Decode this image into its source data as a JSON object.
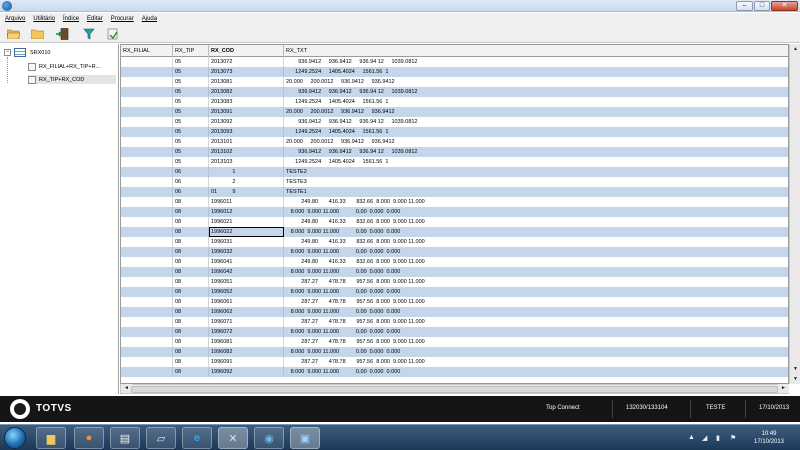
{
  "menu": [
    "Arquivo",
    "Utilitário",
    "Índice",
    "Editar",
    "Procurar",
    "Ajuda"
  ],
  "toolbar": {
    "icons": [
      "open-folder-icon",
      "folder-icon",
      "exit-door-icon",
      "filter-icon",
      "export-icon"
    ]
  },
  "tree": {
    "table_name": "SRX010",
    "indexes": [
      "RX_FILIAL+RX_TIP+R...",
      "RX_TIP+RX_COD"
    ],
    "expander": "−"
  },
  "grid": {
    "columns": [
      "RX_FILIAL",
      "RX_TIP",
      "RX_COD",
      "RX_TXT"
    ],
    "rows": [
      [
        "",
        "05",
        "2013072",
        "        936.9412     936.9412     936.94 12     1039.0812"
      ],
      [
        "",
        "05",
        "2013073",
        "      1249.2524     1405.4024     1561.56  1"
      ],
      [
        "",
        "05",
        "2013081",
        "20.000     200.0012     936.9412     936.9412"
      ],
      [
        "",
        "05",
        "2013082",
        "        936.9412     936.9412     936.94 12     1039.0812"
      ],
      [
        "",
        "05",
        "2013083",
        "      1249.2524     1405.4024     1561.56  1"
      ],
      [
        "",
        "05",
        "2013091",
        "20.000     200.0012     936.9412     936.9412"
      ],
      [
        "",
        "05",
        "2013092",
        "        936.9412     936.9412     936.94 12     1039.0812"
      ],
      [
        "",
        "05",
        "2013093",
        "      1249.2524     1405.4024     1561.56  1"
      ],
      [
        "",
        "05",
        "2013101",
        "20.000     200.0012     936.9412     936.9412"
      ],
      [
        "",
        "05",
        "2013102",
        "        936.9412     936.9412     936.94 12     1039.0812"
      ],
      [
        "",
        "05",
        "2013103",
        "      1249.2524     1405.4024     1561.56  1"
      ],
      [
        "",
        "06",
        "              1",
        "TESTE2"
      ],
      [
        "",
        "06",
        "              2",
        "TESTE3"
      ],
      [
        "",
        "06",
        "01          9",
        "TESTE1"
      ],
      [
        "",
        "08",
        "1996011",
        "          249.80       416.33       832.66  8.000  9.000 11.000"
      ],
      [
        "",
        "08",
        "1996012",
        "   8.000  9.000 11.000           0.00  0.000  0.000"
      ],
      [
        "",
        "08",
        "1996021",
        "          249.80       416.33       832.66  8.000  9.000 11.000"
      ],
      [
        "",
        "08",
        "1996022",
        "   8.000  9.000 11.000           0.00  0.000  0.000"
      ],
      [
        "",
        "08",
        "1996031",
        "          249.80       416.33       832.66  8.000  9.000 11.000"
      ],
      [
        "",
        "08",
        "1996032",
        "   8.000  9.000 11.000           0.00  0.000  0.000"
      ],
      [
        "",
        "08",
        "1996041",
        "          249.80       416.33       832.66  8.000  9.000 11.000"
      ],
      [
        "",
        "08",
        "1996042",
        "   8.000  9.000 11.000           0.00  0.000  0.000"
      ],
      [
        "",
        "08",
        "1996051",
        "          287.27       478.78       957.56  8.000  9.000 11.000"
      ],
      [
        "",
        "08",
        "1996052",
        "   8.000  9.000 11.000           0.00  0.000  0.000"
      ],
      [
        "",
        "08",
        "1996061",
        "          287.27       478.78       957.56  8.000  9.000 11.000"
      ],
      [
        "",
        "08",
        "1996062",
        "   8.000  9.000 11.000           0.00  0.000  0.000"
      ],
      [
        "",
        "08",
        "1996071",
        "          287.27       478.78       957.56  8.000  9.000 11.000"
      ],
      [
        "",
        "08",
        "1996072",
        "   8.000  9.000 11.000           0.00  0.000  0.000"
      ],
      [
        "",
        "08",
        "1996081",
        "          287.27       478.78       957.56  8.000  9.000 11.000"
      ],
      [
        "",
        "08",
        "1996082",
        "   8.000  9.000 11.000           0.00  0.000  0.000"
      ],
      [
        "",
        "08",
        "1996091",
        "          287.27       478.78       957.56  8.000  9.000 11.000"
      ],
      [
        "",
        "08",
        "1996092",
        "   8.000  9.000 11.000           0.00  0.000  0.000"
      ]
    ],
    "focused_row": 17,
    "focused_col": 2
  },
  "scroll": {
    "up": "▲",
    "down": "▼",
    "left": "◄",
    "right": "►"
  },
  "status": {
    "brand": "TOTVS",
    "connection": "Top Connect",
    "server": "132030/133104",
    "user": "TESTE",
    "date": "17/10/2013"
  },
  "window_buttons": {
    "minimize": "–",
    "maximize": "□",
    "close": "✕"
  },
  "taskbar": {
    "apps": [
      "folder-icon",
      "firefox-icon",
      "report-icon",
      "file-icon",
      "ie-icon",
      "tools-icon",
      "network-icon",
      "app-window-icon"
    ],
    "tray_icons": [
      "network-status-icon",
      "volume-icon",
      "power-icon",
      "flag-icon"
    ],
    "time": "10:49",
    "date": "17/10/2013"
  },
  "colors": {
    "row_alt": "#c5d6ea",
    "statusbar": "#151515",
    "taskbar": "#1d3857"
  }
}
